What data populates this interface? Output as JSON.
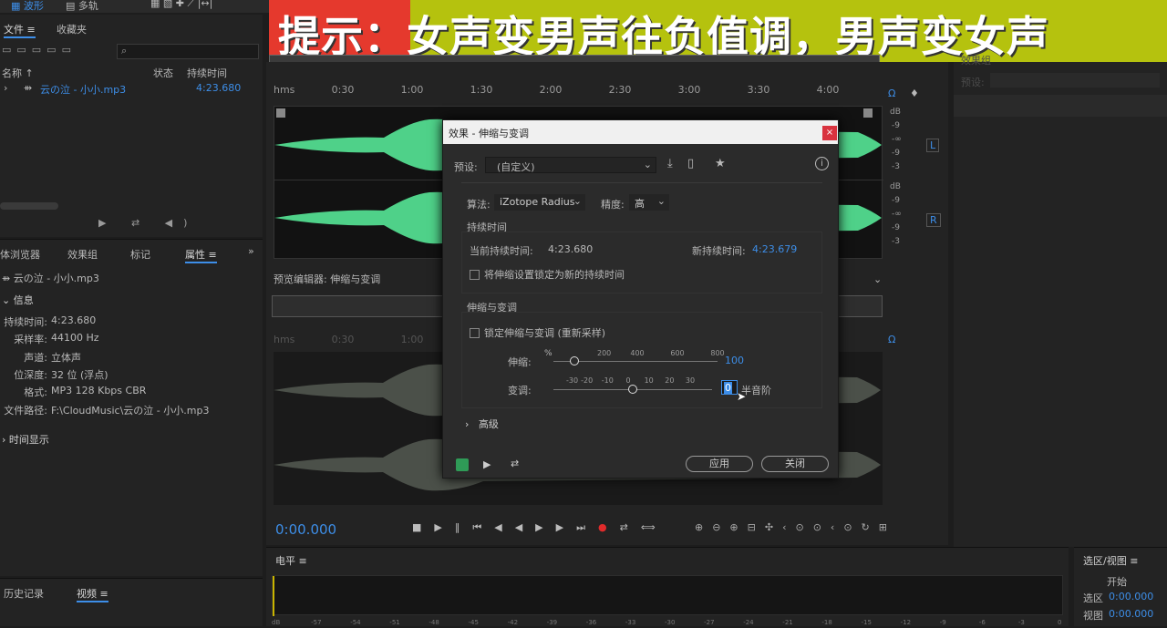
{
  "banner": {
    "text": "提示：女声变男声往负值调，男声变女声"
  },
  "top_tabs": {
    "waveform": "波形",
    "multitrack": "多轨"
  },
  "files_panel": {
    "tab_files": "文件",
    "tab_fav": "收藏夹",
    "col_name": "名称",
    "col_status": "状态",
    "col_duration": "持续时间",
    "file_name": "云の泣 - 小小.mp3",
    "file_duration": "4:23.680"
  },
  "lower_tabs": {
    "media": "体浏览器",
    "effects": "效果组",
    "markers": "标记",
    "props": "属性"
  },
  "props": {
    "file": "云の泣 - 小小.mp3",
    "info": "信息",
    "rows": [
      {
        "k": "持续时间:",
        "v": "4:23.680"
      },
      {
        "k": "采样率:",
        "v": "44100 Hz"
      },
      {
        "k": "声道:",
        "v": "立体声"
      },
      {
        "k": "位深度:",
        "v": "32 位 (浮点)"
      },
      {
        "k": "格式:",
        "v": "MP3 128 Kbps CBR"
      },
      {
        "k": "文件路径:",
        "v": "F:\\CloudMusic\\云の泣 - 小小.mp3"
      }
    ],
    "time_display": "时间显示"
  },
  "bottom_left": {
    "history": "历史记录",
    "video": "视频"
  },
  "timeline": {
    "ticks": [
      "hms",
      "0:30",
      "1:00",
      "1:30",
      "2:00",
      "2:30",
      "3:00",
      "3:30",
      "4:00"
    ]
  },
  "db_scale": [
    "dB",
    "-9",
    "-∞",
    "-9",
    "-3"
  ],
  "channels": {
    "left": "L",
    "right": "R"
  },
  "preview_label": "预览编辑器: 伸缩与变调",
  "preview_ticks": [
    "hms",
    "0:30",
    "1:00"
  ],
  "time_readout": "0:00.000",
  "meter": {
    "label": "电平",
    "scale": [
      "dB",
      "-57",
      "-54",
      "-51",
      "-48",
      "-45",
      "-42",
      "-39",
      "-36",
      "-33",
      "-30",
      "-27",
      "-24",
      "-21",
      "-18",
      "-15",
      "-12",
      "-9",
      "-6",
      "-3",
      "0"
    ]
  },
  "selection_panel": {
    "title": "选区/视图",
    "start": "开始",
    "sel": "选区",
    "view": "视图",
    "sel_val": "0:00.000",
    "view_val": "0:00.000"
  },
  "right_panel": {
    "preset": "预设:",
    "extra": "效果组"
  },
  "dialog": {
    "title": "效果 - 伸缩与变调",
    "preset_label": "预设:",
    "preset_value": "(自定义)",
    "algorithm_label": "算法:",
    "algorithm_value": "iZotope Radius",
    "precision_label": "精度:",
    "precision_value": "高",
    "duration_section": "持续时间",
    "current_label": "当前持续时间:",
    "current_value": "4:23.680",
    "new_label": "新持续时间:",
    "new_value": "4:23.679",
    "lock_duration": "将伸缩设置锁定为新的持续时间",
    "stretch_section": "伸缩与变调",
    "lock_stretch": "锁定伸缩与变调 (重新采样)",
    "stretch_label": "伸缩:",
    "stretch_unit": "%",
    "stretch_ticks": [
      "200",
      "400",
      "600",
      "800"
    ],
    "stretch_value": "100",
    "stretch_level": 100,
    "pitch_label": "变调:",
    "pitch_ticks": [
      "-30",
      "-20",
      "-10",
      "0",
      "10",
      "20",
      "30"
    ],
    "pitch_value": "0",
    "pitch_unit": "半音阶",
    "advanced": "高级",
    "apply": "应用",
    "close": "关闭"
  }
}
